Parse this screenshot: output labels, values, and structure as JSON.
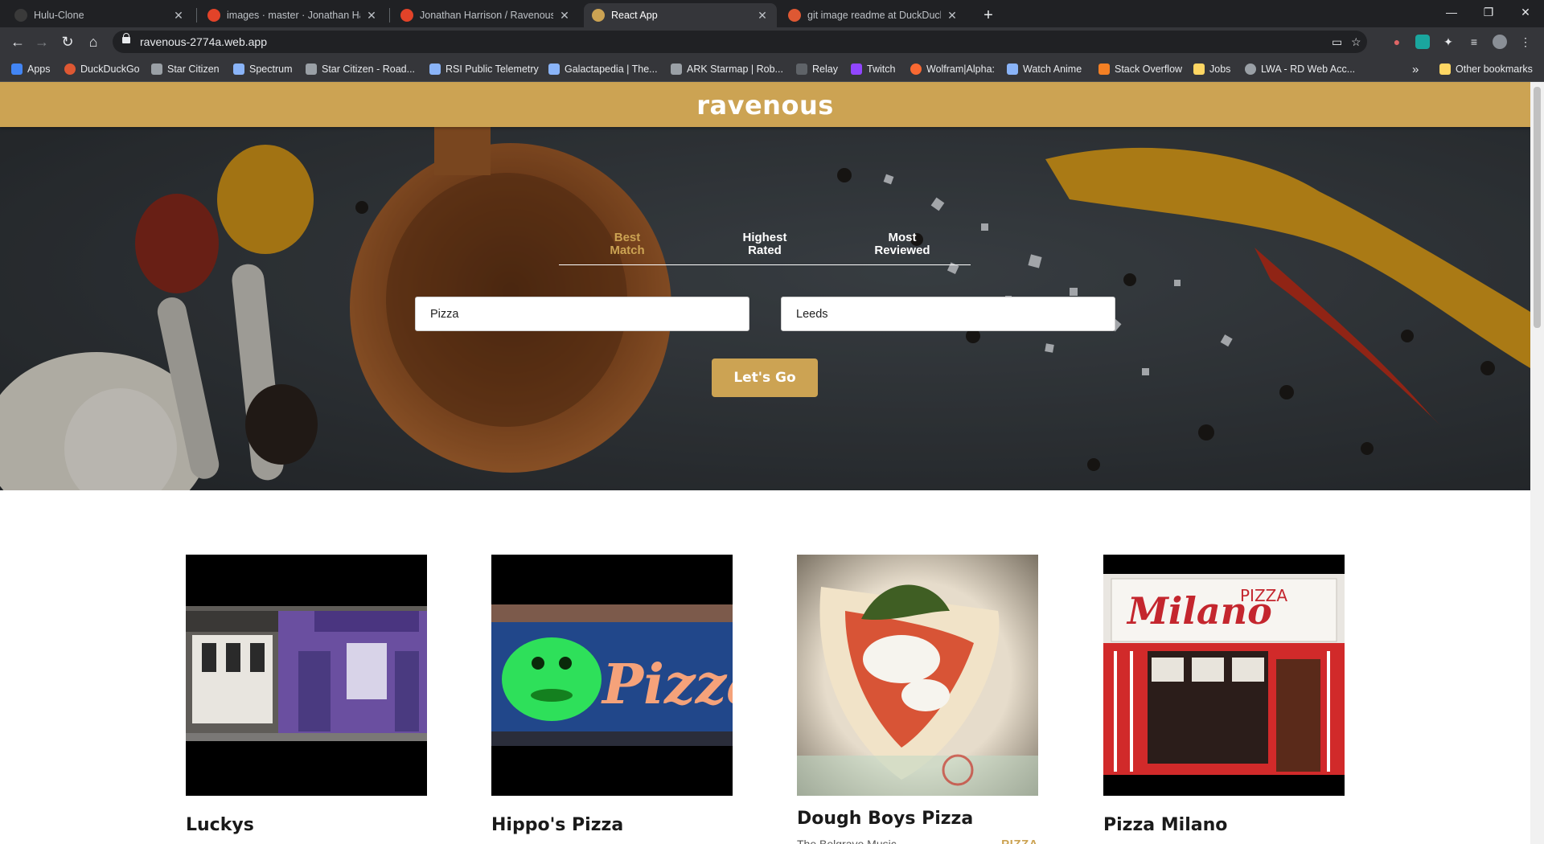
{
  "browser": {
    "tabs": [
      {
        "title": "Hulu-Clone",
        "favicon_color": "#3a3a3a"
      },
      {
        "title": "images · master · Jonathan Harris",
        "favicon_color": "#e24329"
      },
      {
        "title": "Jonathan Harrison / Ravenous · G",
        "favicon_color": "#e24329"
      },
      {
        "title": "React App",
        "favicon_color": "#cca353"
      },
      {
        "title": "git image readme at DuckDuckG",
        "favicon_color": "#de5833"
      }
    ],
    "url": "ravenous-2774a.web.app",
    "bookmarks": [
      {
        "label": "Apps",
        "color": "#4285f4"
      },
      {
        "label": "DuckDuckGo",
        "color": "#de5833"
      },
      {
        "label": "Star Citizen",
        "color": "#9aa0a6"
      },
      {
        "label": "Spectrum",
        "color": "#8ab4f8"
      },
      {
        "label": "Star Citizen - Road...",
        "color": "#9aa0a6"
      },
      {
        "label": "RSI Public Telemetry",
        "color": "#8ab4f8"
      },
      {
        "label": "Galactapedia | The...",
        "color": "#8ab4f8"
      },
      {
        "label": "ARK Starmap | Rob...",
        "color": "#9aa0a6"
      },
      {
        "label": "Relay",
        "color": "#9aa0a6"
      },
      {
        "label": "Twitch",
        "color": "#9146ff"
      },
      {
        "label": "Wolfram|Alpha:",
        "color": "#f96932"
      },
      {
        "label": "Watch Anime",
        "color": "#8ab4f8"
      },
      {
        "label": "Stack Overflow",
        "color": "#f48024"
      },
      {
        "label": "Jobs",
        "color": "#fdd663"
      },
      {
        "label": "LWA - RD Web Acc...",
        "color": "#9aa0a6"
      }
    ],
    "overflow_label": "»",
    "other_bookmarks": "Other bookmarks"
  },
  "site": {
    "logo": "ravenous",
    "sort_options": [
      {
        "line1": "Best",
        "line2": "Match",
        "active": true
      },
      {
        "line1": "Highest",
        "line2": "Rated",
        "active": false
      },
      {
        "line1": "Most",
        "line2": "Reviewed",
        "active": false
      }
    ],
    "search": {
      "term": "Pizza",
      "location": "Leeds"
    },
    "submit_label": "Let's Go",
    "accent_color": "#cca353"
  },
  "results": [
    {
      "name": "Luckys"
    },
    {
      "name": "Hippo's Pizza"
    },
    {
      "name": "Dough Boys Pizza",
      "subtitle": "The Belgrave Music",
      "category": "PIZZA"
    },
    {
      "name": "Pizza Milano"
    }
  ]
}
